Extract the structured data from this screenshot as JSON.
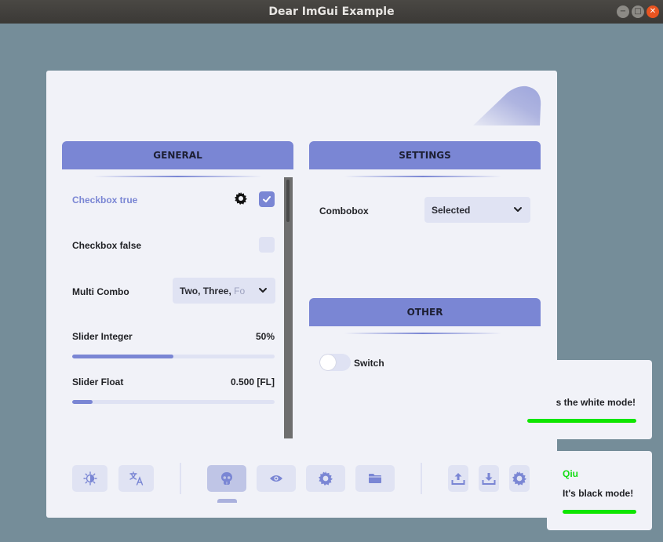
{
  "window": {
    "title": "Dear ImGui Example",
    "buttons": [
      "minimize-icon",
      "maximize-icon",
      "close-icon"
    ]
  },
  "colors": {
    "accent": "#7a86d4",
    "panel_bg": "#f1f2f8",
    "desktop_bg": "#758d99",
    "progress_green": "#0fe600",
    "name_green": "#13dd13"
  },
  "general": {
    "tab_label": "GENERAL",
    "checkbox_true": {
      "label": "Checkbox true",
      "checked": true,
      "icon": "gear-icon"
    },
    "checkbox_false": {
      "label": "Checkbox false",
      "checked": false
    },
    "multi_combo": {
      "label": "Multi Combo",
      "value_main": "Two, Three, ",
      "value_fade": "Fo"
    },
    "slider_integer": {
      "label": "Slider Integer",
      "value_text": "50%",
      "fraction": 0.5
    },
    "slider_float": {
      "label": "Slider Float",
      "value_text": "0.500 [FL]",
      "fraction": 0.1
    }
  },
  "settings": {
    "tab_label": "SETTINGS",
    "combobox": {
      "label": "Combobox",
      "value": "Selected"
    }
  },
  "other": {
    "tab_label": "OTHER",
    "switch": {
      "label": "Switch",
      "on": false
    }
  },
  "toolbar": {
    "left": [
      "theme-icon",
      "translate-icon"
    ],
    "center": [
      "skull-icon",
      "eye-icon",
      "gear-icon",
      "folder-icon"
    ],
    "center_active": "skull-icon",
    "right": [
      "upload-icon",
      "download-icon",
      "gear-icon"
    ]
  },
  "notifications": [
    {
      "message": "s the white mode!",
      "progress": 1.0
    },
    {
      "name": "Qiu",
      "message": "It's black mode!",
      "progress": 1.0
    }
  ]
}
